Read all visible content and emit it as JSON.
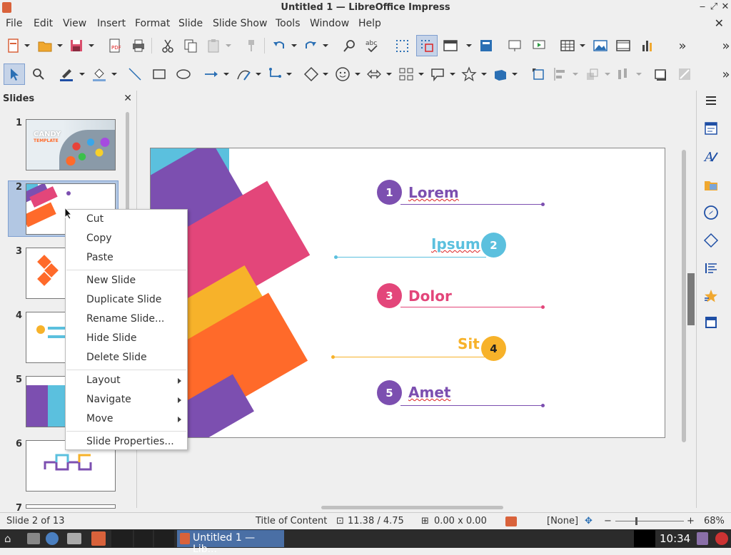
{
  "window": {
    "title": "Untitled 1 — LibreOffice Impress",
    "min": "‒",
    "max": "⤢",
    "close": "✕"
  },
  "menu": [
    "File",
    "Edit",
    "View",
    "Insert",
    "Format",
    "Slide",
    "Slide Show",
    "Tools",
    "Window",
    "Help"
  ],
  "menu_close": "✕",
  "slides_panel": {
    "title": "Slides",
    "close": "✕",
    "thumbs": [
      "1",
      "2",
      "3",
      "4",
      "5",
      "6",
      "7"
    ]
  },
  "thumb1": {
    "title": "CANDY",
    "subtitle": "TEMPLATE"
  },
  "context_menu": {
    "items": [
      "Cut",
      "Copy",
      "Paste",
      "New Slide",
      "Duplicate Slide",
      "Rename Slide...",
      "Hide Slide",
      "Delete Slide",
      "Layout",
      "Navigate",
      "Move",
      "Slide Properties..."
    ]
  },
  "slide": {
    "items": [
      {
        "num": "1",
        "label": "Lorem"
      },
      {
        "num": "2",
        "label": "Ipsum"
      },
      {
        "num": "3",
        "label": "Dolor"
      },
      {
        "num": "4",
        "label": "Sit"
      },
      {
        "num": "5",
        "label": "Amet"
      }
    ],
    "colors": {
      "purple": "#7c4fb0",
      "cyan": "#5bc0de",
      "pink": "#e3467a",
      "orange": "#ff6a2a",
      "yellow": "#f7b22a"
    }
  },
  "status": {
    "slide": "Slide 2 of 13",
    "layout": "Title of Content",
    "position": "11.38 / 4.75",
    "size": "0.00 x 0.00",
    "lang": "[None]",
    "zoom_minus": "−",
    "zoom_plus": "+",
    "zoom": "68%"
  },
  "taskbar": {
    "task": "Untitled 1 — Lib...",
    "clock": "10:34"
  },
  "overflow": "»"
}
